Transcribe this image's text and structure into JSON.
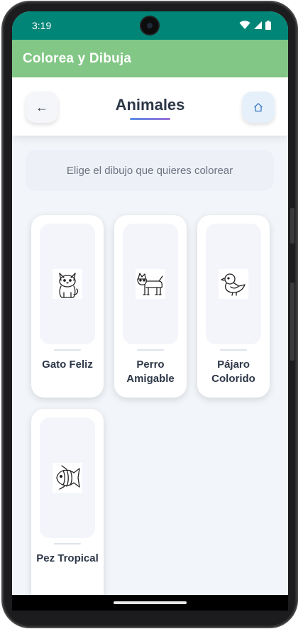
{
  "status_bar": {
    "time": "3:19",
    "icons": [
      "wifi-icon",
      "cell-signal-icon",
      "battery-icon"
    ],
    "color": "#008577"
  },
  "app_bar": {
    "title": "Colorea y Dibuja",
    "color": "#82c785"
  },
  "header": {
    "back_icon": "←",
    "title": "Animales",
    "home_icon": "home-icon"
  },
  "instructions": "Elige el dibujo que quieres colorear",
  "drawings": [
    {
      "label": "Gato Feliz",
      "icon": "cat-icon"
    },
    {
      "label": "Perro Amigable",
      "icon": "dog-icon"
    },
    {
      "label": "Pájaro Colorido",
      "icon": "bird-icon"
    },
    {
      "label": "Pez Tropical",
      "icon": "fish-icon"
    }
  ]
}
